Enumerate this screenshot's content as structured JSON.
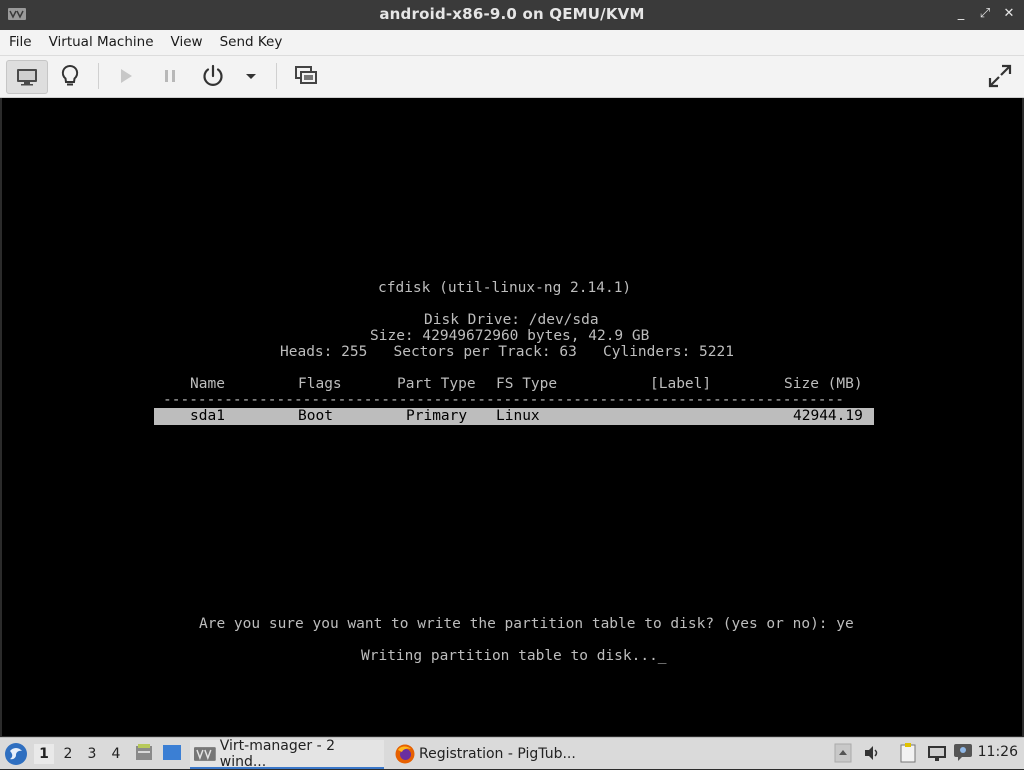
{
  "window": {
    "title": "android-x86-9.0 on QEMU/KVM",
    "controls": [
      "_",
      "⤢",
      "✕"
    ]
  },
  "menu": [
    "File",
    "Virtual Machine",
    "View",
    "Send Key"
  ],
  "toolbar": {
    "icons": [
      "monitor-icon",
      "lightbulb-icon",
      "play-icon",
      "pause-icon",
      "power-icon",
      "dropdown-icon",
      "snapshots-icon",
      "fullscreen-icon"
    ]
  },
  "terminal": {
    "header": "cfdisk (util-linux-ng 2.14.1)",
    "disk_drive": "Disk Drive: /dev/sda",
    "size": "Size: 42949672960 bytes, 42.9 GB",
    "geometry": "Heads: 255   Sectors per Track: 63   Cylinders: 5221",
    "columns": [
      "Name",
      "Flags",
      "Part Type",
      "FS Type",
      "[Label]",
      "Size (MB)"
    ],
    "rule": "------------------------------------------------------------------------------",
    "rows": [
      {
        "name": "sda1",
        "flags": "Boot",
        "part_type": "Primary",
        "fs_type": "Linux",
        "label": "",
        "size": "42944.19"
      }
    ],
    "prompt": "Are you sure you want to write the partition table to disk? (yes or no): ye",
    "status": "Writing partition table to disk..._"
  },
  "taskbar": {
    "workspaces": [
      "1",
      "2",
      "3",
      "4"
    ],
    "active_workspace": "1",
    "tasks": [
      "Virt-manager - 2 wind...",
      "Registration - PigTub..."
    ],
    "clock": "11:26"
  }
}
